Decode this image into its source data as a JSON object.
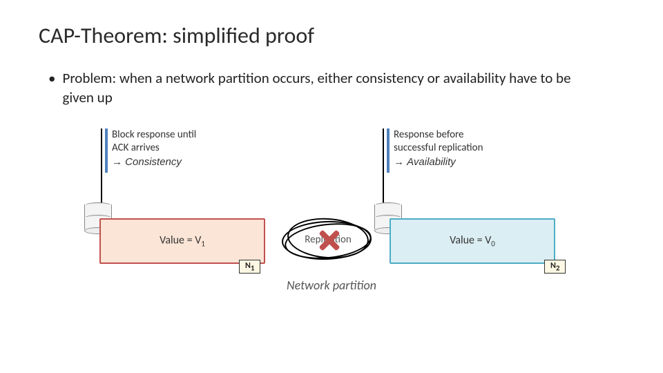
{
  "title": "CAP-Theorem: simplified proof",
  "bullet": "Problem: when a network partition occurs, either consistency or availability have to be given up",
  "callout_left": {
    "line1": "Block response until",
    "line2": "ACK arrives",
    "line3_prefix": "→ ",
    "line3_em": "Consistency"
  },
  "callout_right": {
    "line1": "Response before",
    "line2": "successful replication",
    "line3_prefix": "→ ",
    "line3_em": "Availability"
  },
  "node1": {
    "label_prefix": "Value = V",
    "label_sub": "1",
    "tag_prefix": "N",
    "tag_sub": "1"
  },
  "node2": {
    "label_prefix": "Value = V",
    "label_sub": "0",
    "tag_prefix": "N",
    "tag_sub": "2"
  },
  "replication_label": "Replication",
  "partition_caption": "Network partition"
}
